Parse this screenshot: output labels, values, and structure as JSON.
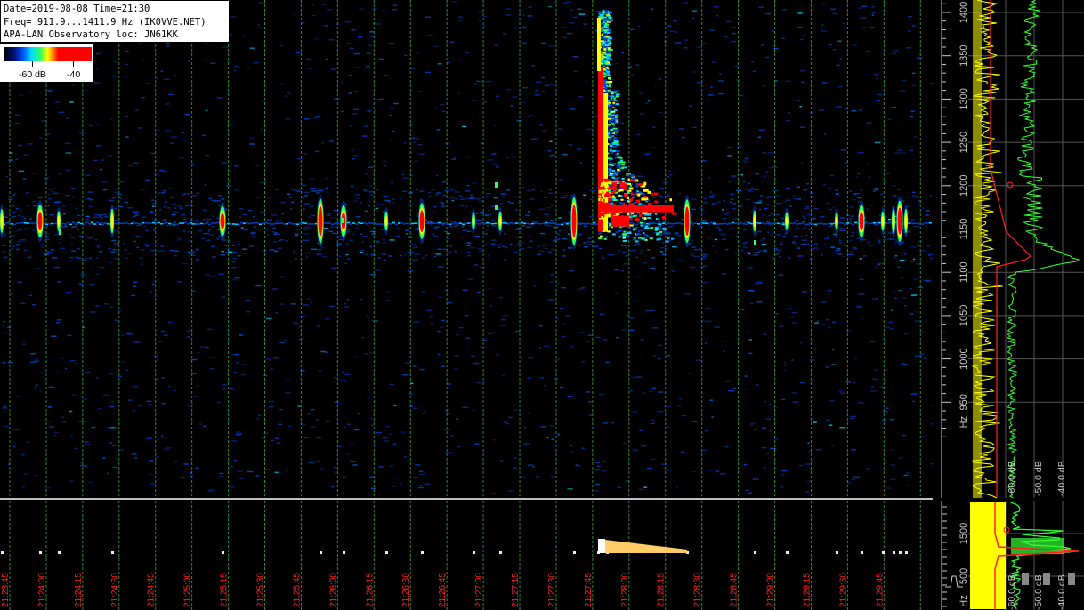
{
  "info": {
    "line1": "Date=2019-08-08 Time=21:30",
    "line2": "Freq= 911.9...1411.9 Hz (IK0VVE.NET)",
    "line3": "APA-LAN Observatory loc: JN61KK"
  },
  "legend": {
    "label_low": "-60 dB",
    "label_high": "-40",
    "colors": [
      "#000000",
      "#001070",
      "#0050ff",
      "#00e0ff",
      "#30ff60",
      "#ffff00",
      "#ff8000",
      "#ff0000"
    ]
  },
  "time_axis": {
    "labels": [
      "21:23:45",
      "21:24:00",
      "21:24:15",
      "21:24:30",
      "21:24:45",
      "21:25:00",
      "21:25:15",
      "21:25:30",
      "21:25:45",
      "21:26:00",
      "21:26:15",
      "21:26:30",
      "21:26:45",
      "21:27:00",
      "21:27:15",
      "21:27:30",
      "21:27:45",
      "21:28:00",
      "21:28:15",
      "21:28:30",
      "21:28:45",
      "21:29:00",
      "21:29:15",
      "21:29:30",
      "21:29:45"
    ]
  },
  "freq_axis": {
    "labels": [
      "1400",
      "1350",
      "1300",
      "1250",
      "1200",
      "1150",
      "1100",
      "1050",
      "1000",
      "950"
    ],
    "unit": "Hz"
  },
  "db_axis": {
    "labels": [
      "-60.0 dB",
      "-50.0 dB",
      "-40.0 dB"
    ]
  },
  "bottom_freq_axis": {
    "labels": [
      "1500",
      "500"
    ],
    "unit": "Hz"
  },
  "bottom_db_axis": {
    "labels": [
      "-60.0 dB",
      "-50.0 dB",
      "-40.0 dB"
    ]
  },
  "colors": {
    "background": "#000000",
    "grid_line": "#2e8a2e",
    "time_label": "#ff2020",
    "signal_hot": "#ff0000",
    "signal_warm": "#ffff00",
    "signal_mid": "#30ff60",
    "signal_cool": "#00d0ff",
    "signal_dim": "#0040c0",
    "trace_yellow": "#ffff00",
    "trace_green": "#33ff33",
    "trace_red": "#ff2020"
  }
}
